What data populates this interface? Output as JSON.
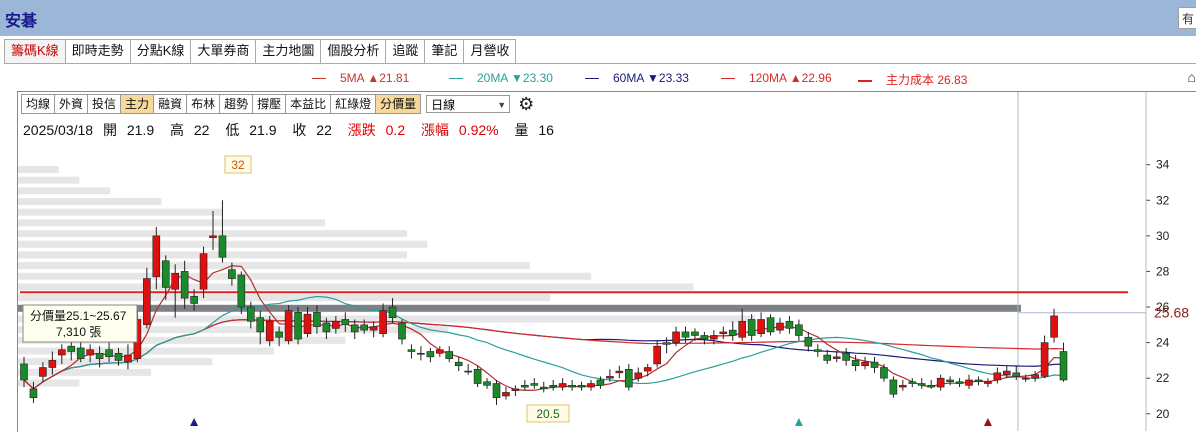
{
  "window": {
    "title": "安碁",
    "corner_label": "有"
  },
  "tabs": [
    "籌碼K線",
    "即時走勢",
    "分點K線",
    "大單券商",
    "主力地圖",
    "個股分析",
    "追蹤",
    "筆記",
    "月營收"
  ],
  "legend": [
    {
      "label": "5MA",
      "arrow": "▲",
      "value": "21.81",
      "color": "#c0392b"
    },
    {
      "label": "20MA",
      "arrow": "▼",
      "value": "23.30",
      "color": "#2aa198"
    },
    {
      "label": "60MA",
      "arrow": "▼",
      "value": "23.33",
      "color": "#1a1a7a"
    },
    {
      "label": "120MA",
      "arrow": "▲",
      "value": "22.96",
      "color": "#d42a2a"
    },
    {
      "label": "主力成本",
      "value": "26.83",
      "color": "#e02020"
    }
  ],
  "toolbar": {
    "buttons": [
      "均線",
      "外資",
      "投信",
      "主力",
      "融資",
      "布林",
      "趨勢",
      "撐壓",
      "本益比",
      "紅綠燈",
      "分價量"
    ],
    "active": [
      "主力",
      "分價量"
    ],
    "period": "日線"
  },
  "info": {
    "date": "2025/03/18",
    "open_label": "開",
    "open": "21.9",
    "high_label": "高",
    "high": "22",
    "low_label": "低",
    "low": "21.9",
    "close_label": "收",
    "close": "22",
    "change_label": "漲跌",
    "change": "0.2",
    "pct_label": "漲幅",
    "pct": "0.92%",
    "vol_label": "量",
    "vol": "16"
  },
  "tooltip": {
    "line1": "分價量25.1~25.67",
    "line2": "7,310 張"
  },
  "annotations": {
    "high_marker": "32",
    "low_marker": "20.5",
    "price_now": "25.68"
  },
  "chart_data": {
    "type": "candlestick",
    "y_ticks": [
      20,
      22,
      24,
      26,
      28,
      30,
      32,
      34
    ],
    "ylim": [
      19.2,
      35.5
    ],
    "main_cost": 26.83,
    "candles": [
      [
        22.8,
        21.9,
        23.2,
        21.5
      ],
      [
        21.4,
        20.9,
        21.8,
        20.6
      ],
      [
        22.1,
        22.6,
        22.9,
        21.8
      ],
      [
        22.6,
        23.0,
        23.5,
        22.2
      ],
      [
        23.3,
        23.6,
        23.9,
        22.8
      ],
      [
        23.8,
        23.5,
        24.3,
        23.0
      ],
      [
        23.7,
        23.1,
        24.6,
        22.9
      ],
      [
        23.3,
        23.6,
        23.9,
        22.9
      ],
      [
        23.4,
        23.1,
        23.8,
        22.6
      ],
      [
        23.6,
        23.2,
        24.0,
        22.9
      ],
      [
        23.4,
        23.0,
        23.7,
        22.7
      ],
      [
        22.9,
        23.3,
        23.9,
        22.5
      ],
      [
        23.1,
        25.3,
        25.8,
        22.9
      ],
      [
        25.0,
        27.6,
        28.2,
        24.8
      ],
      [
        27.7,
        30.0,
        30.5,
        27.0
      ],
      [
        28.6,
        27.1,
        28.9,
        26.4
      ],
      [
        27.0,
        27.9,
        28.4,
        25.4
      ],
      [
        28.0,
        26.5,
        28.6,
        25.9
      ],
      [
        26.6,
        26.2,
        27.0,
        25.8
      ],
      [
        27.0,
        29.0,
        29.4,
        26.5
      ],
      [
        29.9,
        30.0,
        31.4,
        29.2
      ],
      [
        30.0,
        28.8,
        32.0,
        28.5
      ],
      [
        28.1,
        27.6,
        28.5,
        27.2
      ],
      [
        27.8,
        26.0,
        28.0,
        25.6
      ],
      [
        26.0,
        25.2,
        26.3,
        24.8
      ],
      [
        25.4,
        24.6,
        25.8,
        23.9
      ],
      [
        24.1,
        25.2,
        25.5,
        23.8
      ],
      [
        24.6,
        24.3,
        24.9,
        23.8
      ],
      [
        24.1,
        25.8,
        26.1,
        23.9
      ],
      [
        25.7,
        24.2,
        26.0,
        23.9
      ],
      [
        24.5,
        25.6,
        26.0,
        24.3
      ],
      [
        25.7,
        24.9,
        26.1,
        24.5
      ],
      [
        25.1,
        24.6,
        25.4,
        24.2
      ],
      [
        24.8,
        25.2,
        25.5,
        24.5
      ],
      [
        25.3,
        25.0,
        25.7,
        24.6
      ],
      [
        25.0,
        24.6,
        25.3,
        24.2
      ],
      [
        25.0,
        24.7,
        25.3,
        24.5
      ],
      [
        24.7,
        24.9,
        25.2,
        24.3
      ],
      [
        24.5,
        25.8,
        26.2,
        24.3
      ],
      [
        26.0,
        25.4,
        26.5,
        25.1
      ],
      [
        25.1,
        24.2,
        25.3,
        23.9
      ],
      [
        23.6,
        23.5,
        23.9,
        23.1
      ],
      [
        23.4,
        23.4,
        23.8,
        23.0
      ],
      [
        23.5,
        23.2,
        23.7,
        22.9
      ],
      [
        23.4,
        23.6,
        23.8,
        23.2
      ],
      [
        23.5,
        23.1,
        23.8,
        22.9
      ],
      [
        22.9,
        22.7,
        23.2,
        22.4
      ],
      [
        22.4,
        22.4,
        22.8,
        22.2
      ],
      [
        22.5,
        21.7,
        22.7,
        21.5
      ],
      [
        21.8,
        21.6,
        22.0,
        21.4
      ],
      [
        21.7,
        20.9,
        21.9,
        20.5
      ],
      [
        21.0,
        21.2,
        21.5,
        20.8
      ],
      [
        21.3,
        21.4,
        21.6,
        21.0
      ],
      [
        21.6,
        21.5,
        21.9,
        21.3
      ],
      [
        21.7,
        21.6,
        22.0,
        21.4
      ],
      [
        21.5,
        21.4,
        21.8,
        21.2
      ],
      [
        21.6,
        21.5,
        21.9,
        21.3
      ],
      [
        21.5,
        21.7,
        22.0,
        21.3
      ],
      [
        21.6,
        21.5,
        21.9,
        21.3
      ],
      [
        21.6,
        21.5,
        21.8,
        21.3
      ],
      [
        21.5,
        21.7,
        21.9,
        21.3
      ],
      [
        21.9,
        21.6,
        22.1,
        21.4
      ],
      [
        22.0,
        22.1,
        22.5,
        21.8
      ],
      [
        22.3,
        22.4,
        22.7,
        22.0
      ],
      [
        22.5,
        21.5,
        22.8,
        21.3
      ],
      [
        22.0,
        22.3,
        22.6,
        21.8
      ],
      [
        22.4,
        22.6,
        22.8,
        22.1
      ],
      [
        22.8,
        23.8,
        24.1,
        22.6
      ],
      [
        24.0,
        23.9,
        24.3,
        23.4
      ],
      [
        24.0,
        24.6,
        24.9,
        23.8
      ],
      [
        24.6,
        24.3,
        24.9,
        24.0
      ],
      [
        24.6,
        24.4,
        24.8,
        24.1
      ],
      [
        24.4,
        24.2,
        24.6,
        23.9
      ],
      [
        24.2,
        24.4,
        24.7,
        23.9
      ],
      [
        24.5,
        24.6,
        24.9,
        24.2
      ],
      [
        24.7,
        24.4,
        25.2,
        24.1
      ],
      [
        24.3,
        25.2,
        25.9,
        24.1
      ],
      [
        25.3,
        24.4,
        25.6,
        24.1
      ],
      [
        24.5,
        25.3,
        25.7,
        24.3
      ],
      [
        25.4,
        24.6,
        25.6,
        24.4
      ],
      [
        24.7,
        25.1,
        25.4,
        24.5
      ],
      [
        25.2,
        24.8,
        25.5,
        24.5
      ],
      [
        25.0,
        24.4,
        25.3,
        24.1
      ],
      [
        24.3,
        23.8,
        24.6,
        23.5
      ],
      [
        23.6,
        23.5,
        23.9,
        23.2
      ],
      [
        23.3,
        23.0,
        23.6,
        22.8
      ],
      [
        23.1,
        23.2,
        23.5,
        22.9
      ],
      [
        23.4,
        23.0,
        23.7,
        22.7
      ],
      [
        23.0,
        22.7,
        23.3,
        22.4
      ],
      [
        22.7,
        22.9,
        23.2,
        22.5
      ],
      [
        22.9,
        22.6,
        23.2,
        22.3
      ],
      [
        22.6,
        22.0,
        22.8,
        21.8
      ],
      [
        21.9,
        21.1,
        22.1,
        20.9
      ],
      [
        21.5,
        21.6,
        21.9,
        21.3
      ],
      [
        21.8,
        21.7,
        22.0,
        21.5
      ],
      [
        21.7,
        21.6,
        22.0,
        21.4
      ],
      [
        21.6,
        21.5,
        21.9,
        21.4
      ],
      [
        21.5,
        22.0,
        22.2,
        21.3
      ],
      [
        21.9,
        21.8,
        22.1,
        21.6
      ],
      [
        21.8,
        21.7,
        22.0,
        21.5
      ],
      [
        21.6,
        21.9,
        22.2,
        21.4
      ],
      [
        21.9,
        21.8,
        22.1,
        21.6
      ],
      [
        21.7,
        21.8,
        22.0,
        21.5
      ],
      [
        21.9,
        22.3,
        22.6,
        21.7
      ],
      [
        22.2,
        22.4,
        22.7,
        22.0
      ],
      [
        22.3,
        22.1,
        22.7,
        21.9
      ],
      [
        22.0,
        22.0,
        22.2,
        21.8
      ],
      [
        22.0,
        22.2,
        22.4,
        21.8
      ],
      [
        22.1,
        24.0,
        24.4,
        22.0
      ],
      [
        24.3,
        25.5,
        25.9,
        24.0
      ],
      [
        23.5,
        21.9,
        24.0,
        21.8
      ]
    ],
    "volume_profile": [
      {
        "price": 33.7,
        "vol": 40
      },
      {
        "price": 33.1,
        "vol": 60
      },
      {
        "price": 32.5,
        "vol": 90
      },
      {
        "price": 31.9,
        "vol": 140
      },
      {
        "price": 31.3,
        "vol": 200
      },
      {
        "price": 30.7,
        "vol": 300
      },
      {
        "price": 30.1,
        "vol": 380
      },
      {
        "price": 29.5,
        "vol": 400
      },
      {
        "price": 28.9,
        "vol": 380
      },
      {
        "price": 28.3,
        "vol": 500
      },
      {
        "price": 27.7,
        "vol": 560
      },
      {
        "price": 27.1,
        "vol": 660
      },
      {
        "price": 26.5,
        "vol": 520
      },
      {
        "price": 25.9,
        "vol": 980
      },
      {
        "price": 25.3,
        "vol": 720
      },
      {
        "price": 24.7,
        "vol": 420
      },
      {
        "price": 24.1,
        "vol": 320
      },
      {
        "price": 23.5,
        "vol": 250
      },
      {
        "price": 22.9,
        "vol": 190
      },
      {
        "price": 22.3,
        "vol": 130
      },
      {
        "price": 21.7,
        "vol": 60
      }
    ],
    "markers": [
      {
        "index": 18,
        "type": "triangle-up",
        "color": "#1a1a8a"
      },
      {
        "index": 82,
        "type": "triangle-up",
        "color": "#2aa198"
      },
      {
        "index": 102,
        "type": "triangle-up",
        "color": "#a01010"
      }
    ]
  }
}
